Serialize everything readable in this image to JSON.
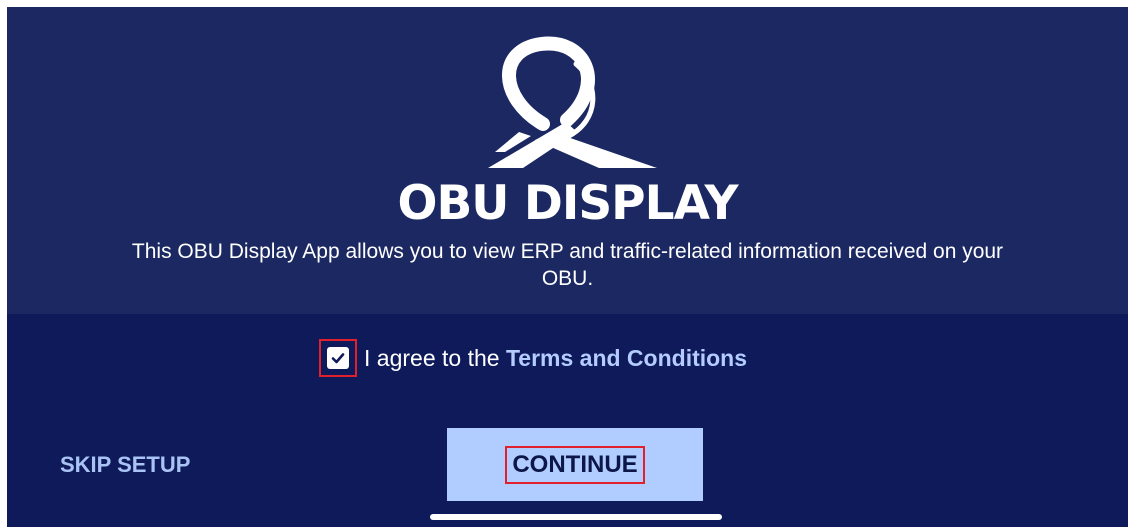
{
  "colors": {
    "upper_background": "#1b2862",
    "lower_background": "#0e1a5a",
    "link": "#b4ccff",
    "continue_background": "#b1cdff",
    "highlight_outline": "#e0202a"
  },
  "header": {
    "logo_icon": "obu-loop-road-logo-icon",
    "title": "OBU DISPLAY",
    "description": "This OBU Display App allows you to view ERP and traffic-related information received on your OBU."
  },
  "agreement": {
    "checked": true,
    "checkbox_icon": "checkmark-icon",
    "prefix": "I agree to the",
    "link_text": "Terms and Conditions"
  },
  "actions": {
    "skip_label": "SKIP SETUP",
    "continue_label": "CONTINUE"
  }
}
